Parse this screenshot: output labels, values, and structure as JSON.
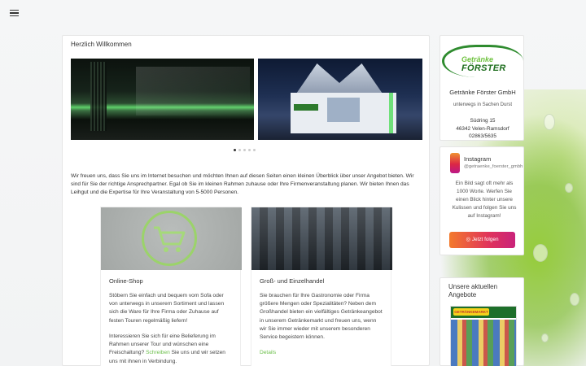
{
  "nav": {
    "menu_icon": "hamburger-menu-icon"
  },
  "main": {
    "title": "Herzlich Willkommen",
    "slider_dots": 5,
    "slider_active": 1,
    "intro": "Wir freuen uns, dass Sie uns im Internet besuchen und möchten Ihnen auf diesen Seiten einen kleinen Überblick über unser Angebot bieten. Wir sind für Sie der richtige Ansprechpartner. Egal ob Sie im kleinen Rahmen zuhause oder Ihre Firmenveranstaltung planen. Wir bieten Ihnen das Leihgut und die Expertise für Ihre Veranstaltung von 5-5000 Personen."
  },
  "tiles": [
    {
      "title": "Online-Shop",
      "p1": "Stöbern Sie einfach und bequem vom Sofa oder von unterwegs in unserem Sortiment und lassen sich die Ware für Ihre Firma oder Zuhause auf festen Touren regelmäßig liefern!",
      "p2_before": "Interessieren Sie sich für eine Belieferung im Rahmen unserer Tour und wünschen eine Freischaltung? ",
      "p2_link": "Schreiben",
      "p2_after": " Sie uns und wir setzen uns mit ihnen in Verbindung.",
      "icon": "shopping-cart-icon"
    },
    {
      "title": "Groß- und Einzelhandel",
      "p1": "Sie brauchen für Ihre Gastronomie oder Firma größere Mengen oder Spezialitäten? Neben dem Großhandel bieten ein vielfältiges Getränkeangebot in unserem Getränkemarkt und freuen uns, wenn wir Sie immer wieder mit unserem besonderen Service begeistern können.",
      "link": "Details"
    }
  ],
  "company": {
    "logo_line1": "Getränke",
    "logo_line2": "FÖRSTER",
    "name": "Getränke Förster GmbH",
    "tagline": "unterwegs in Sachen Durst",
    "street": "Südring 15",
    "city": "46342 Velen-Ramsdorf",
    "phone": "02863/5635"
  },
  "instagram": {
    "title": "Instagram",
    "user": "@getraenke_foerster_gmbh",
    "text": "Ein Bild sagt oft mehr als 1000 Worte. Werfen Sie einen Blick hinter unsere Kulissen und folgen Sie uns auf Instagram!",
    "button": "Jetzt folgen",
    "icon": "instagram-icon"
  },
  "offers": {
    "title": "Unsere aktuellen Angebote",
    "flyer_label": "GETRÄNKEMARKT"
  },
  "colors": {
    "accent_green": "#6bbf4a",
    "brand_dark_green": "#1e6e1e"
  }
}
